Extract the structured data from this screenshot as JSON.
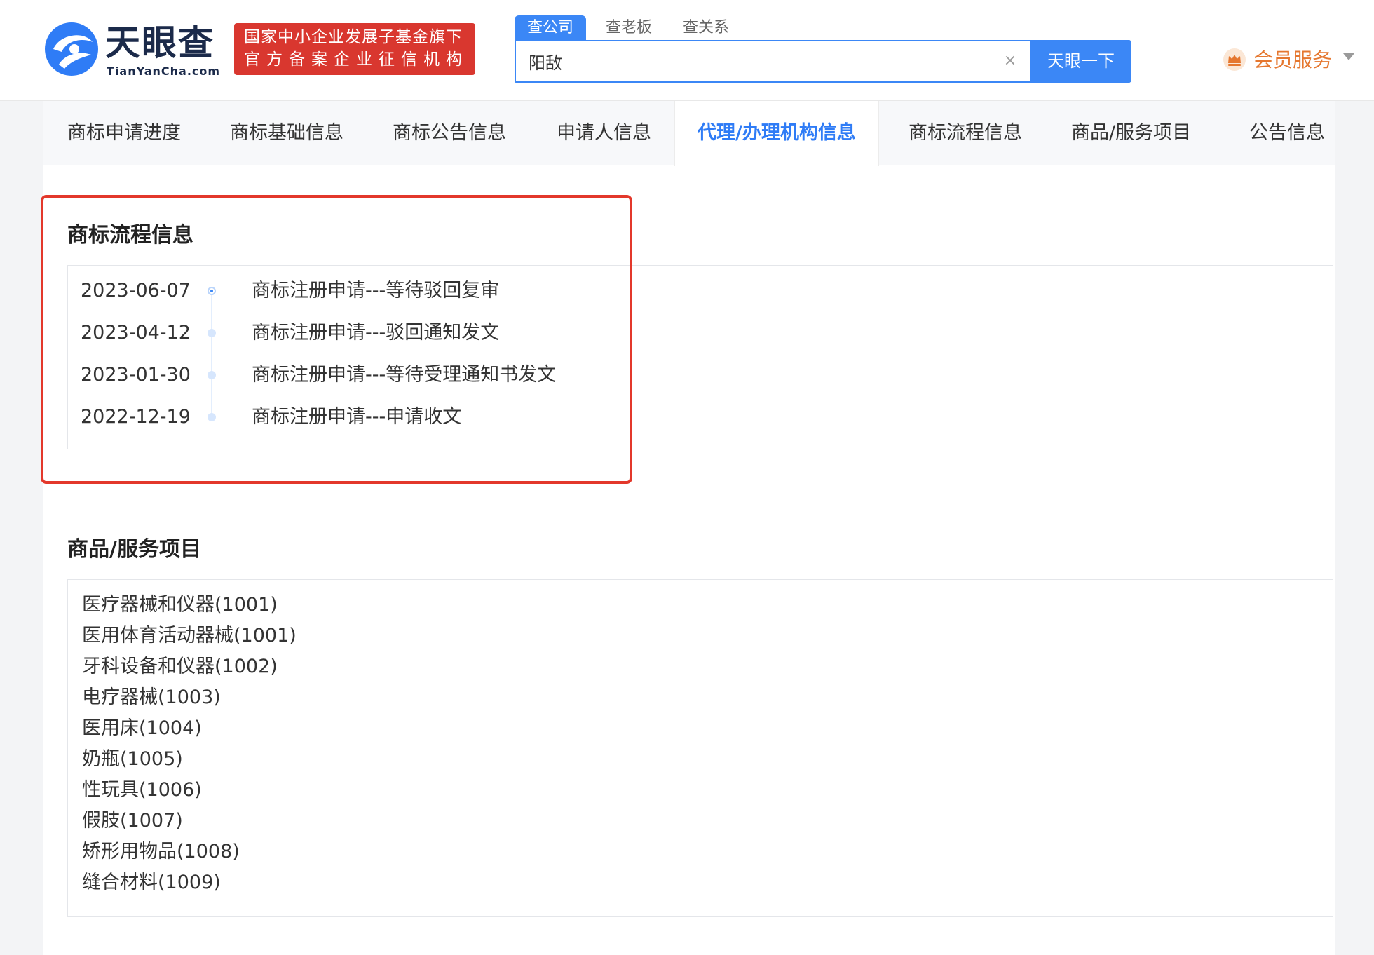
{
  "header": {
    "logo": {
      "name": "天眼查",
      "sub": "TianYanCha.com"
    },
    "badge": {
      "line1": "国家中小企业发展子基金旗下",
      "line2": "官方备案企业征信机构"
    },
    "search_tabs": [
      "查公司",
      "查老板",
      "查关系"
    ],
    "search": {
      "value": "阳敌",
      "button_label": "天眼一下",
      "clear_icon": "×"
    },
    "vip": {
      "label": "会员服务"
    }
  },
  "nav_tabs": [
    {
      "label": "商标申请进度"
    },
    {
      "label": "商标基础信息"
    },
    {
      "label": "商标公告信息"
    },
    {
      "label": "申请人信息"
    },
    {
      "label": "代理/办理机构信息"
    },
    {
      "label": "商标流程信息"
    },
    {
      "label": "商品/服务项目"
    },
    {
      "label": "公告信息"
    }
  ],
  "process": {
    "title": "商标流程信息",
    "items": [
      {
        "date": "2023-06-07",
        "text": "商标注册申请---等待驳回复审"
      },
      {
        "date": "2023-04-12",
        "text": "商标注册申请---驳回通知发文"
      },
      {
        "date": "2023-01-30",
        "text": "商标注册申请---等待受理通知书发文"
      },
      {
        "date": "2022-12-19",
        "text": "商标注册申请---申请收文"
      }
    ]
  },
  "goods": {
    "title": "商品/服务项目",
    "items": [
      "医疗器械和仪器(1001)",
      "医用体育活动器械(1001)",
      "牙科设备和仪器(1002)",
      "电疗器械(1003)",
      "医用床(1004)",
      "奶瓶(1005)",
      "性玩具(1006)",
      "假肢(1007)",
      "矫形用物品(1008)",
      "缝合材料(1009)"
    ]
  },
  "colors": {
    "primary": "#3b87f6",
    "badge": "#d9372f",
    "highlight": "#e3382b",
    "vip": "#e5772f"
  }
}
